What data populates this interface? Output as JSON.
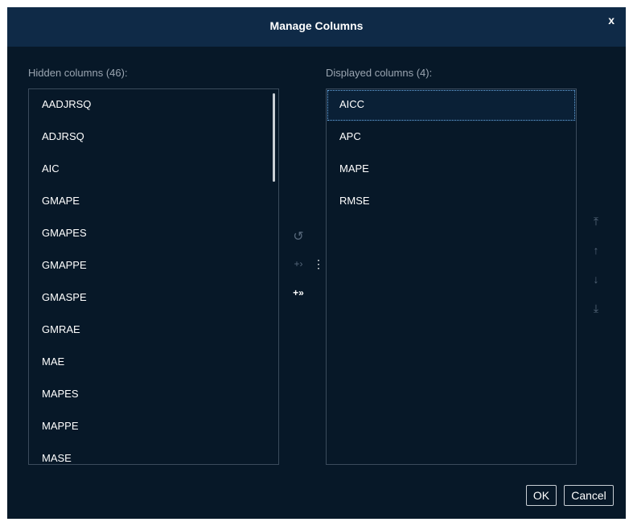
{
  "dialog": {
    "title": "Manage Columns",
    "close": "x"
  },
  "hidden": {
    "label": "Hidden columns (46):",
    "items": [
      "AADJRSQ",
      "ADJRSQ",
      "AIC",
      "GMAPE",
      "GMAPES",
      "GMAPPE",
      "GMASPE",
      "GMRAE",
      "MAE",
      "MAPES",
      "MAPPE",
      "MASE"
    ]
  },
  "displayed": {
    "label": "Displayed columns (4):",
    "items": [
      "AICC",
      "APC",
      "MAPE",
      "RMSE"
    ]
  },
  "icons": {
    "undo": "↺",
    "add": "+›",
    "add_all": "+»",
    "more": "⋮",
    "top": "⤒",
    "up": "↑",
    "down": "↓",
    "bottom": "⤓"
  },
  "buttons": {
    "ok": "OK",
    "cancel": "Cancel"
  }
}
